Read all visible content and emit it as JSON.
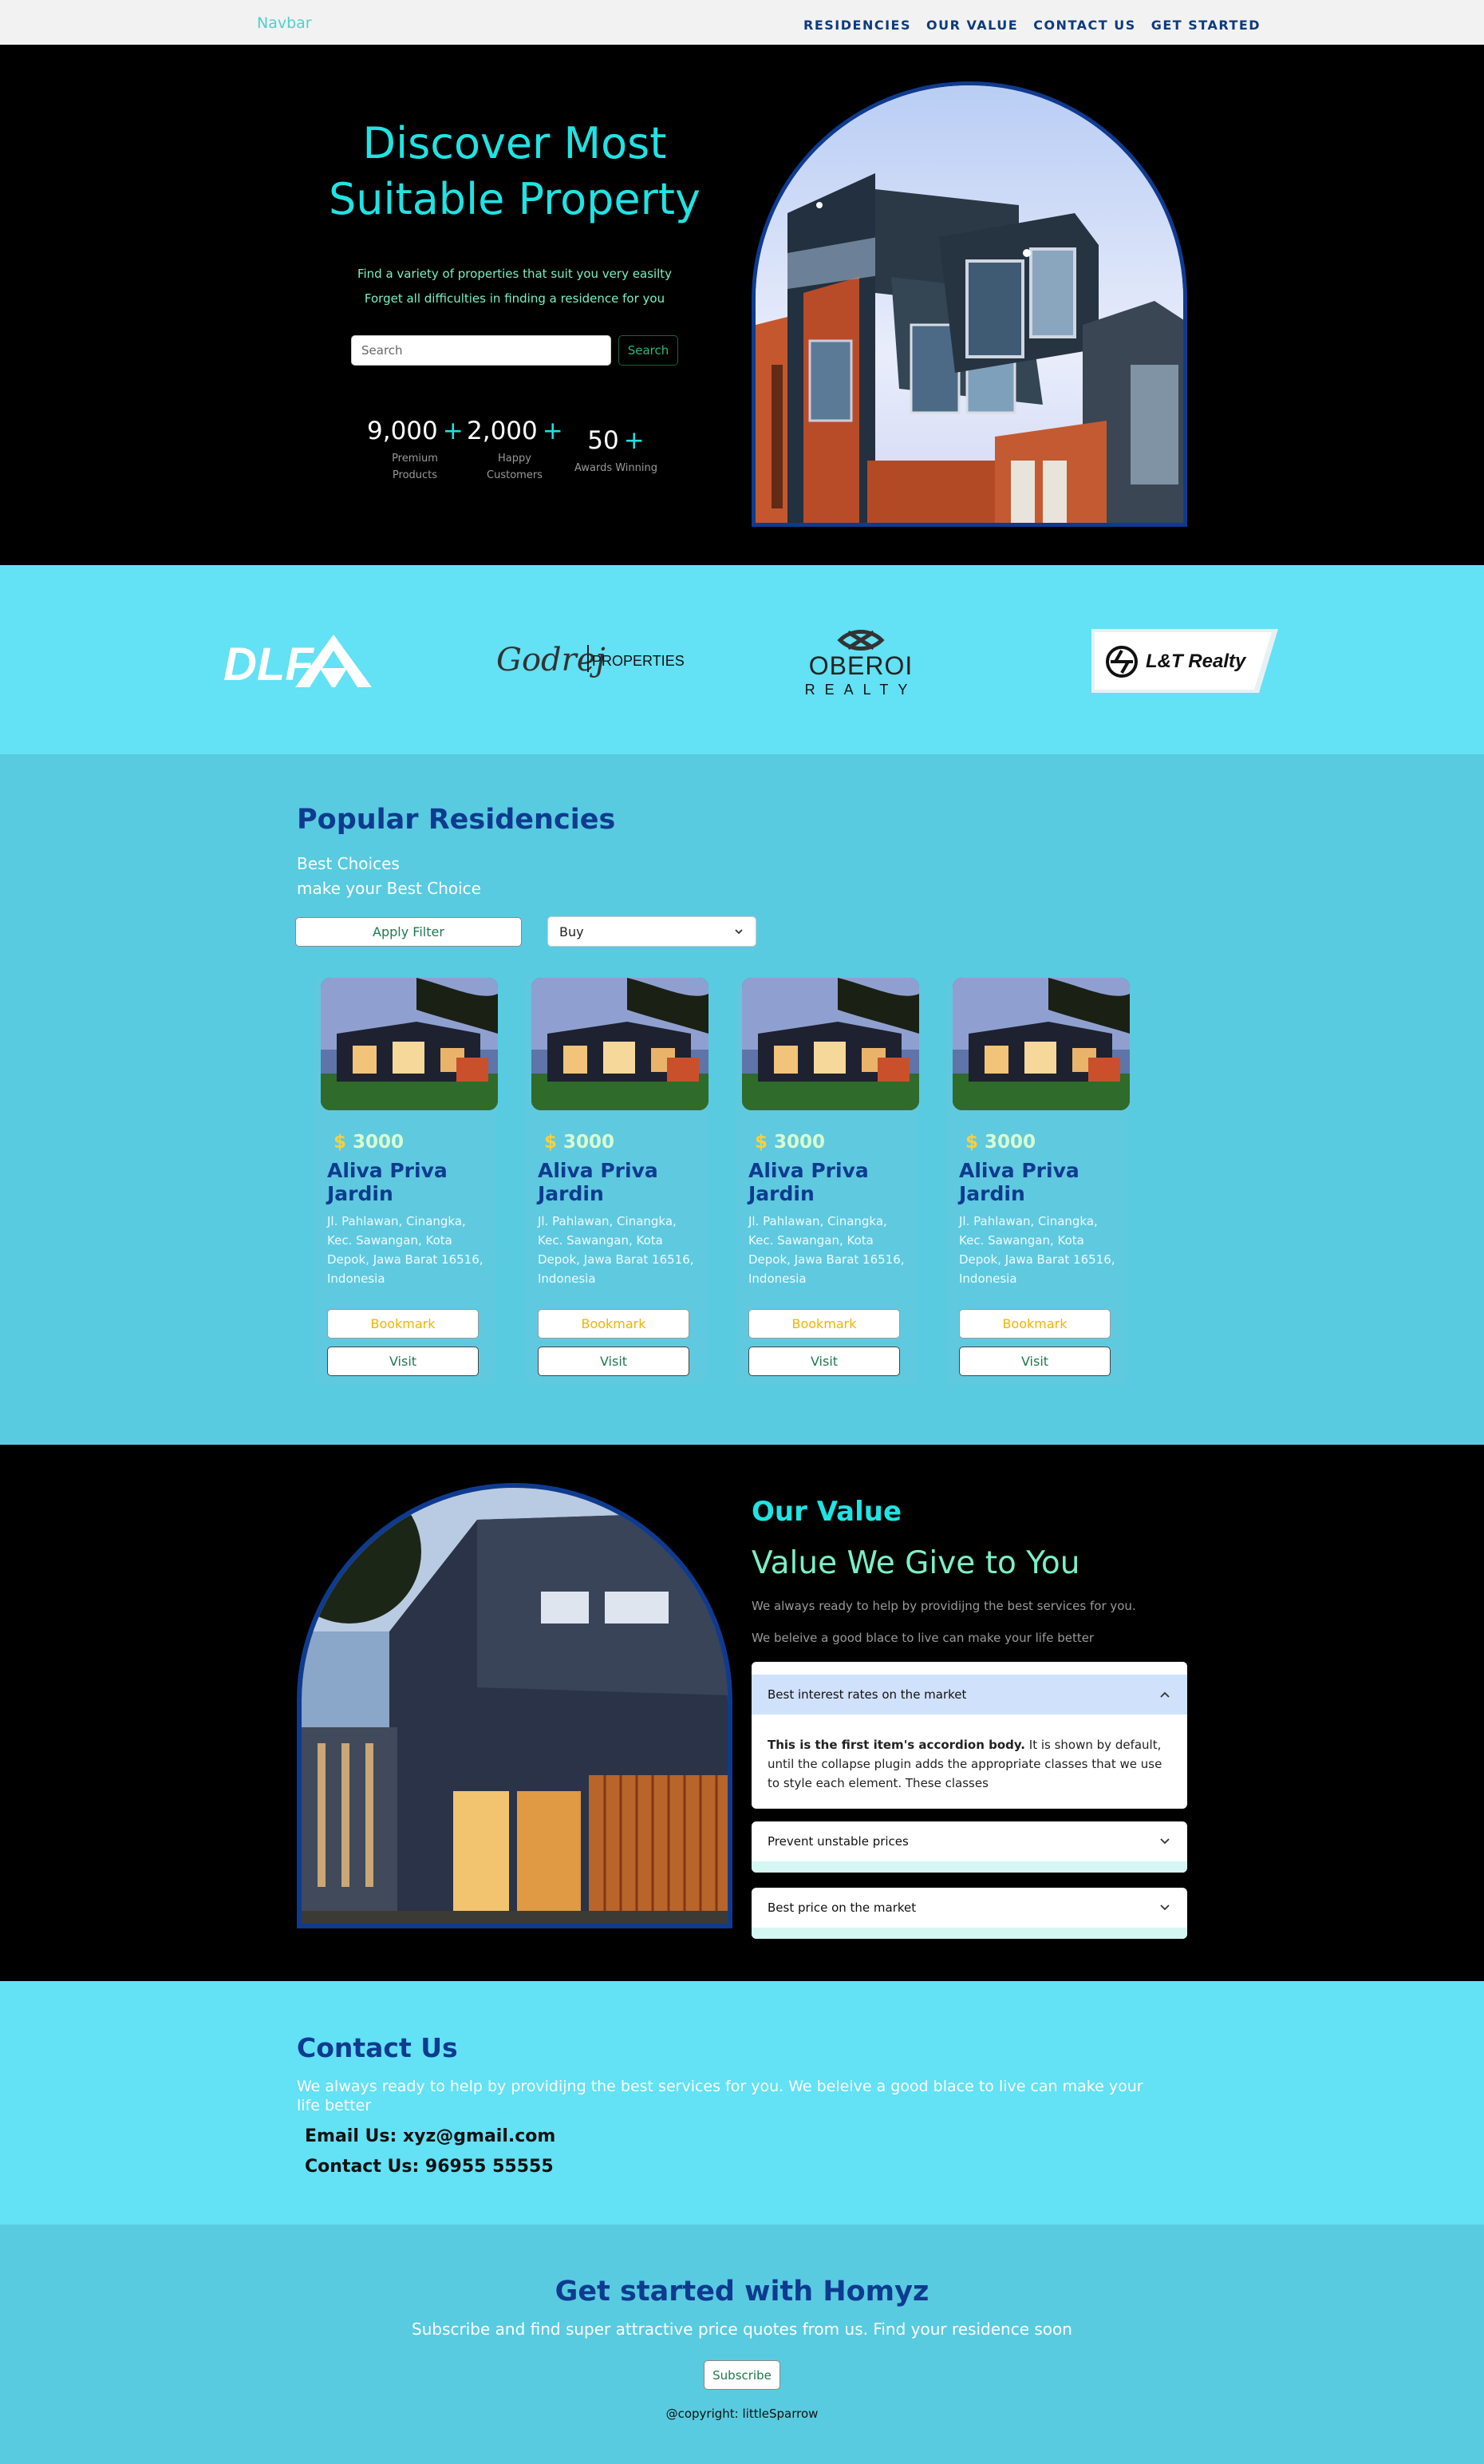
{
  "navbar": {
    "brand": "Navbar",
    "links": [
      "RESIDENCIES",
      "OUR VALUE",
      "CONTACT US",
      "GET STARTED"
    ]
  },
  "hero": {
    "title_line1": "Discover Most",
    "title_line2": "Suitable Property",
    "sub_line1": "Find a variety of properties that suit you very easilty",
    "sub_line2": "Forget all difficulties in finding a residence for you",
    "search_placeholder": "Search",
    "search_button": "Search",
    "plus": "+",
    "stats": [
      {
        "number": "9,000",
        "label1": "Premium",
        "label2": "Products"
      },
      {
        "number": "2,000",
        "label1": "Happy",
        "label2": "Customers"
      },
      {
        "number": "50",
        "label1": "Awards Winning",
        "label2": ""
      }
    ]
  },
  "partners": {
    "dlf": "DLF",
    "godrej": "Godrej",
    "godrej_suffix": "PROPERTIES",
    "oberoi": "OBEROI",
    "oberoi_suffix": "REALTY",
    "lt": "L&T Realty"
  },
  "residencies": {
    "title": "Popular Residencies",
    "sub_line1": "Best Choices",
    "sub_line2": "make your Best Choice",
    "filter_button": "Apply Filter",
    "select_value": "Buy",
    "cards": [
      {
        "currency": "$",
        "price": "3000",
        "name": "Aliva Priva Jardin",
        "address": "Jl. Pahlawan, Cinangka, Kec. Sawangan, Kota Depok, Jawa Barat 16516, Indonesia",
        "bookmark": "Bookmark",
        "visit": "Visit"
      },
      {
        "currency": "$",
        "price": "3000",
        "name": "Aliva Priva Jardin",
        "address": "Jl. Pahlawan, Cinangka, Kec. Sawangan, Kota Depok, Jawa Barat 16516, Indonesia",
        "bookmark": "Bookmark",
        "visit": "Visit"
      },
      {
        "currency": "$",
        "price": "3000",
        "name": "Aliva Priva Jardin",
        "address": "Jl. Pahlawan, Cinangka, Kec. Sawangan, Kota Depok, Jawa Barat 16516, Indonesia",
        "bookmark": "Bookmark",
        "visit": "Visit"
      },
      {
        "currency": "$",
        "price": "3000",
        "name": "Aliva Priva Jardin",
        "address": "Jl. Pahlawan, Cinangka, Kec. Sawangan, Kota Depok, Jawa Barat 16516, Indonesia",
        "bookmark": "Bookmark",
        "visit": "Visit"
      }
    ]
  },
  "value": {
    "title": "Our Value",
    "subtitle": "Value We Give to You",
    "p1": "We always ready to help by providijng the best services for you.",
    "p2": "We beleive a good blace to live can make your life better",
    "accordion": [
      {
        "title": "Best interest rates on the market",
        "body_bold": "This is the first item's accordion body.",
        "body_rest": " It is shown by default, until the collapse plugin adds the appropriate classes that we use to style each element. These classes",
        "expanded": true
      },
      {
        "title": "Prevent unstable prices",
        "expanded": false
      },
      {
        "title": "Best price on the market",
        "expanded": false
      }
    ]
  },
  "contact": {
    "title": "Contact Us",
    "paragraph": "We always ready to help by providijng the best services for you. We beleive a good blace to live can make your life better",
    "email": "Email Us: xyz@gmail.com",
    "phone": "Contact Us: 96955 55555"
  },
  "footer": {
    "title": "Get started with Homyz",
    "subtitle": "Subscribe and find super attractive price quotes from us. Find your residence soon",
    "subscribe_button": "Subscribe",
    "copyright": "@copyright: littleSparrow"
  },
  "colors": {
    "accent_cyan": "#20e3e3",
    "mint": "#7af0c8",
    "navy": "#0e3b8f",
    "light_cyan_bg": "#63e1f5",
    "mid_cyan_bg": "#58cbe0"
  },
  "icons": [
    "chevron-down-icon",
    "chevron-up-icon",
    "lt-logo-icon"
  ]
}
